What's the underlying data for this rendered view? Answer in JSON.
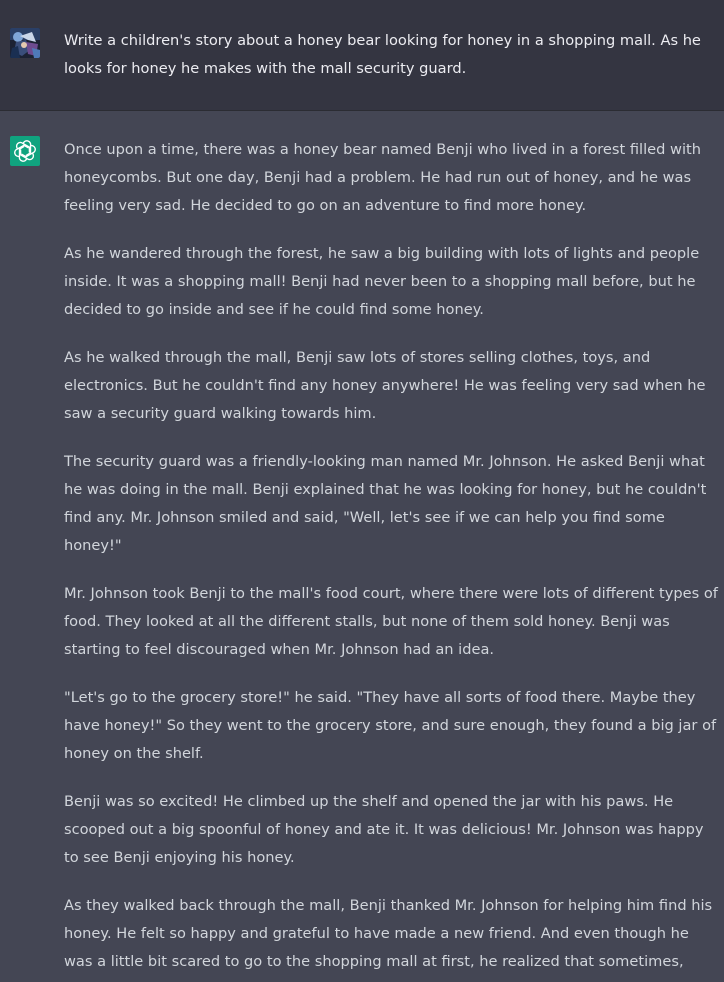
{
  "conversation": {
    "user_message": {
      "avatar_icon": "user-avatar-image",
      "text": "Write a children's story about a honey bear looking for honey in a shopping mall. As he looks for honey he makes with the mall security guard."
    },
    "assistant_message": {
      "avatar_icon": "openai-logo-icon",
      "accent_color": "#10a37f",
      "paragraphs": [
        "Once upon a time, there was a honey bear named Benji who lived in a forest filled with honeycombs. But one day, Benji had a problem. He had run out of honey, and he was feeling very sad. He decided to go on an adventure to find more honey.",
        "As he wandered through the forest, he saw a big building with lots of lights and people inside. It was a shopping mall! Benji had never been to a shopping mall before, but he decided to go inside and see if he could find some honey.",
        "As he walked through the mall, Benji saw lots of stores selling clothes, toys, and electronics. But he couldn't find any honey anywhere! He was feeling very sad when he saw a security guard walking towards him.",
        "The security guard was a friendly-looking man named Mr. Johnson. He asked Benji what he was doing in the mall. Benji explained that he was looking for honey, but he couldn't find any. Mr. Johnson smiled and said, \"Well, let's see if we can help you find some honey!\"",
        "Mr. Johnson took Benji to the mall's food court, where there were lots of different types of food. They looked at all the different stalls, but none of them sold honey. Benji was starting to feel discouraged when Mr. Johnson had an idea.",
        "\"Let's go to the grocery store!\" he said. \"They have all sorts of food there. Maybe they have honey!\" So they went to the grocery store, and sure enough, they found a big jar of honey on the shelf.",
        "Benji was so excited! He climbed up the shelf and opened the jar with his paws. He scooped out a big spoonful of honey and ate it. It was delicious! Mr. Johnson was happy to see Benji enjoying his honey.",
        "As they walked back through the mall, Benji thanked Mr. Johnson for helping him find his honey. He felt so happy and grateful to have made a new friend. And even though he was a little bit scared to go to the shopping mall at first, he realized that sometimes, unexpected adventures can lead to new discoveries and new friendships."
      ]
    }
  }
}
